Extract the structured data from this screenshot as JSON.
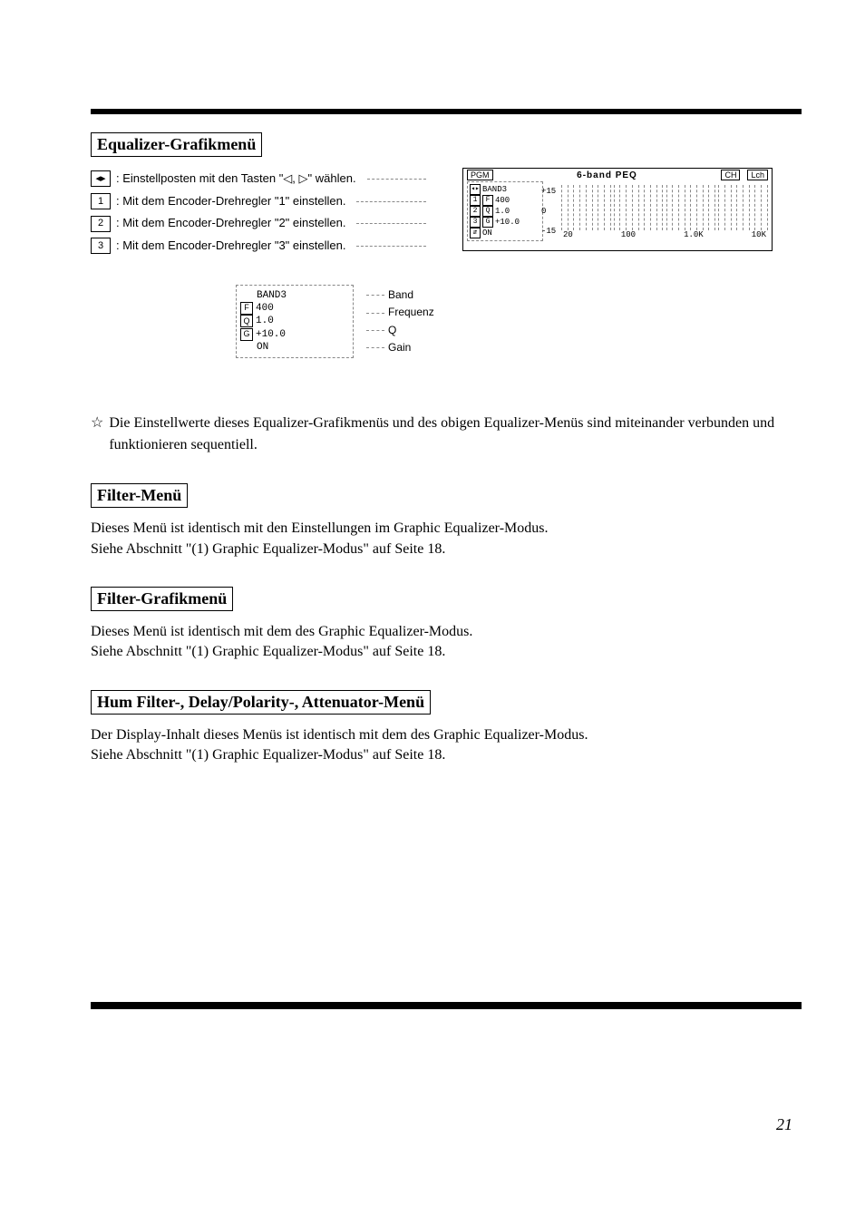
{
  "section1_title": "Equalizer-Grafikmenü",
  "instructions": {
    "arrow_symbol": "◂▸",
    "arrow_text": ": Einstellposten mit den Tasten \"◁, ▷\" wählen.",
    "k1": "1",
    "k1_text": ": Mit dem Encoder-Drehregler \"1\" einstellen.",
    "k2": "2",
    "k2_text": ": Mit dem Encoder-Drehregler \"2\" einstellen.",
    "k3": "3",
    "k3_text": ": Mit dem Encoder-Drehregler \"3\" einstellen."
  },
  "screen": {
    "pgm": "PGM",
    "title": "6-band PEQ",
    "ch": "CH",
    "lch": "Lch",
    "band": "BAND3",
    "freq": "400",
    "q": "1.0",
    "gain": "+10.0",
    "state": "ON",
    "scale_top": "+15",
    "scale_mid": "0",
    "scale_bot": "-15",
    "x1": "20",
    "x2": "100",
    "x3": "1.0K",
    "x4": "10K",
    "left_F": "F",
    "left_Q": "Q",
    "left_G": "G",
    "left_1": "1",
    "left_2": "2",
    "left_3": "3"
  },
  "callout": {
    "band": "BAND3",
    "freq": "400",
    "q": "1.0",
    "gain": "+10.0",
    "state": "ON",
    "lbl_band": "Band",
    "lbl_freq": "Frequenz",
    "lbl_q": "Q",
    "lbl_gain": "Gain",
    "F": "F",
    "Q": "Q",
    "G": "G"
  },
  "note_text": "Die Einstellwerte dieses Equalizer-Grafikmenüs und des obigen Equalizer-Menüs sind miteinander verbunden und funktionieren sequentiell.",
  "section2_title": "Filter-Menü",
  "section2_body_l1": "Dieses Menü ist identisch mit den Einstellungen im Graphic Equalizer-Modus.",
  "section2_body_l2": "Siehe Abschnitt \"(1) Graphic Equalizer-Modus\" auf Seite 18.",
  "section3_title": "Filter-Grafikmenü",
  "section3_body_l1": "Dieses Menü ist identisch mit dem des Graphic Equalizer-Modus.",
  "section3_body_l2": "Siehe Abschnitt \"(1) Graphic Equalizer-Modus\" auf Seite 18.",
  "section4_title": "Hum Filter-, Delay/Polarity-, Attenuator-Menü",
  "section4_body_l1": "Der Display-Inhalt dieses Menüs ist identisch mit dem des Graphic Equalizer-Modus.",
  "section4_body_l2": "Siehe Abschnitt \"(1) Graphic Equalizer-Modus\" auf Seite 18.",
  "page_number": "21"
}
